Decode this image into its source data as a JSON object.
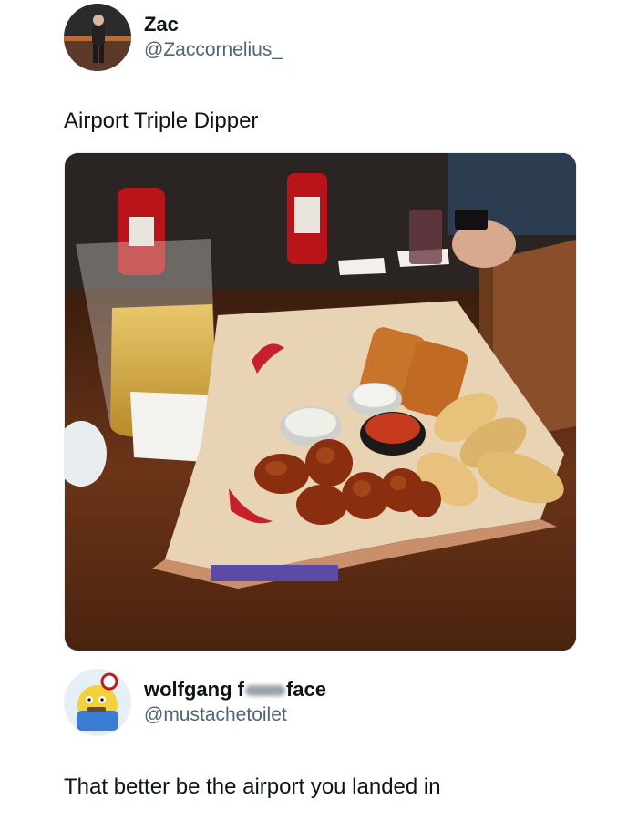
{
  "tweet": {
    "author": {
      "display_name": "Zac",
      "handle": "@Zaccornelius_"
    },
    "text": "Airport Triple Dipper",
    "image": {
      "alt": "",
      "icon": "photo",
      "colors": {
        "table": "#5a2d14",
        "paper": "#ead6b8",
        "wings": "#8a2e10",
        "ketchup": "#b8141a",
        "beer": "#d9b14a"
      }
    }
  },
  "reply": {
    "author": {
      "display_name_start": "wolfgang f",
      "display_name_end": "face",
      "handle": "@mustachetoilet"
    },
    "text": "That better be the airport you landed in"
  }
}
